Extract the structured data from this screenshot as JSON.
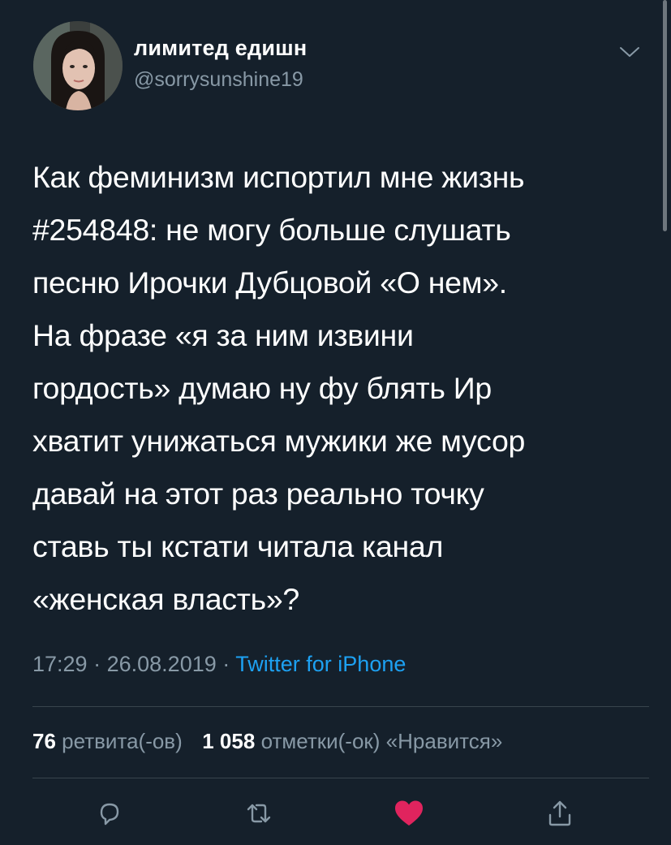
{
  "user": {
    "display_name": "лимитед едишн",
    "handle": "@sorrysunshine19",
    "avatar_icon": "profile-photo"
  },
  "tweet": {
    "lines": [
      "Как феминизм испортил мне жизнь",
      "#254848: не могу больше слушать",
      "песню Ирочки Дубцовой «О нем».",
      "На фразе «я за ним извини",
      "гордость» думаю ну фу блять Ир",
      "хватит унижаться мужики же мусор",
      "давай на этот раз реально точку",
      "ставь ты кстати читала канал",
      "«женская власть»?"
    ]
  },
  "meta": {
    "time": "17:29",
    "separator": "·",
    "date": "26.08.2019",
    "source": "Twitter for iPhone"
  },
  "stats": {
    "retweets_count": "76",
    "retweets_label": "ретвита(-ов)",
    "likes_count": "1 058",
    "likes_label": "отметки(-ок) «Нравится»"
  },
  "colors": {
    "background": "#15202b",
    "text": "#ffffff",
    "secondary": "#8899a6",
    "link": "#1da1f2",
    "like": "#e0245e",
    "divider": "#38444d"
  },
  "icons": {
    "more": "chevron-down-icon",
    "reply": "reply-icon",
    "retweet": "retweet-icon",
    "like": "heart-icon",
    "share": "share-icon"
  }
}
